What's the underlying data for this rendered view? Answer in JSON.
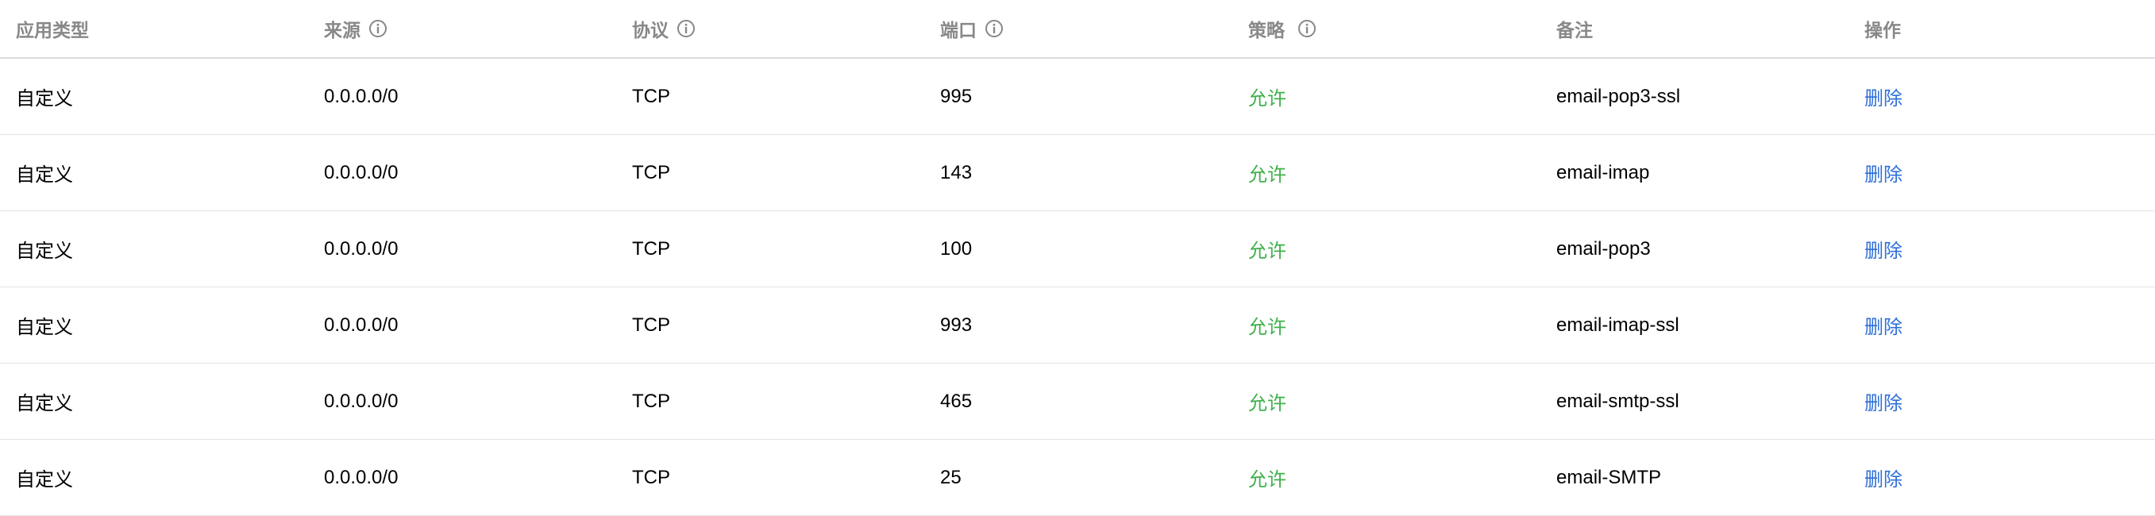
{
  "columns": [
    {
      "label": "应用类型",
      "info_icon": false
    },
    {
      "label": "来源",
      "info_icon": true
    },
    {
      "label": "协议",
      "info_icon": true
    },
    {
      "label": "端口",
      "info_icon": true
    },
    {
      "label": "策略",
      "info_icon": true
    },
    {
      "label": "备注",
      "info_icon": false
    },
    {
      "label": "操作",
      "info_icon": false
    }
  ],
  "rows": [
    {
      "app_type": "自定义",
      "source": "0.0.0.0/0",
      "protocol": "TCP",
      "port": "995",
      "policy": "允许",
      "remark": "email-pop3-ssl",
      "action": "删除"
    },
    {
      "app_type": "自定义",
      "source": "0.0.0.0/0",
      "protocol": "TCP",
      "port": "143",
      "policy": "允许",
      "remark": "email-imap",
      "action": "删除"
    },
    {
      "app_type": "自定义",
      "source": "0.0.0.0/0",
      "protocol": "TCP",
      "port": "100",
      "policy": "允许",
      "remark": "email-pop3",
      "action": "删除"
    },
    {
      "app_type": "自定义",
      "source": "0.0.0.0/0",
      "protocol": "TCP",
      "port": "993",
      "policy": "允许",
      "remark": "email-imap-ssl",
      "action": "删除"
    },
    {
      "app_type": "自定义",
      "source": "0.0.0.0/0",
      "protocol": "TCP",
      "port": "465",
      "policy": "允许",
      "remark": "email-smtp-ssl",
      "action": "删除"
    },
    {
      "app_type": "自定义",
      "source": "0.0.0.0/0",
      "protocol": "TCP",
      "port": "25",
      "policy": "允许",
      "remark": "email-SMTP",
      "action": "删除"
    }
  ],
  "colors": {
    "header_text": "#888888",
    "allow": "#3fb04b",
    "link": "#2e6fd8",
    "divider": "#e3e3e3"
  },
  "icons": {
    "info": "info-circle-icon"
  }
}
